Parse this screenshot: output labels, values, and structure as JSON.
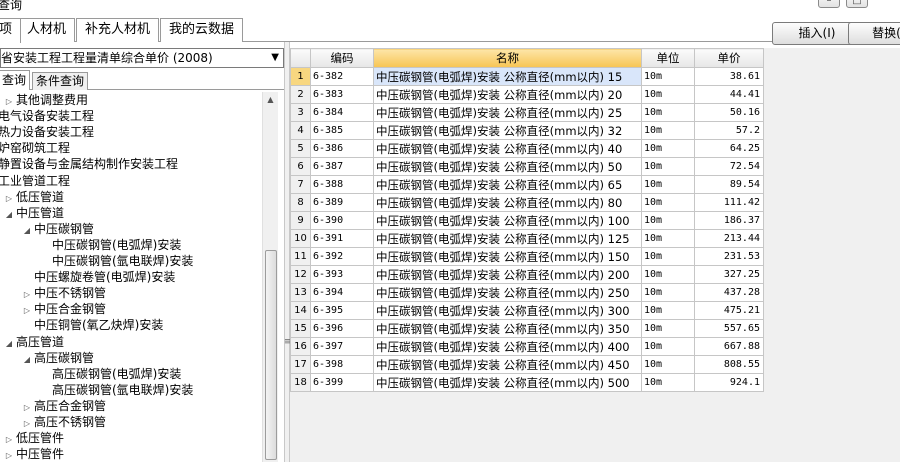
{
  "window": {
    "title": "查询",
    "btn_min": "–",
    "btn_max": "□"
  },
  "tabs": [
    {
      "label": "项",
      "active": true
    },
    {
      "label": "人材机"
    },
    {
      "label": "补充人材机"
    },
    {
      "label": "我的云数据"
    }
  ],
  "toolbar": {
    "insert_label": "插入(I)",
    "replace_label": "替换(R)"
  },
  "left": {
    "selected_library": "省安装工程工程量清单综合单价 (2008)",
    "subtabs": [
      "查询",
      "条件查询"
    ],
    "tree": [
      {
        "label": "其他调整费用",
        "level": 1,
        "toggle": "▷"
      },
      {
        "label": "电气设备安装工程",
        "level": 0,
        "toggle": ""
      },
      {
        "label": "热力设备安装工程",
        "level": 0,
        "toggle": ""
      },
      {
        "label": "炉窑砌筑工程",
        "level": 0,
        "toggle": ""
      },
      {
        "label": "静置设备与金属结构制作安装工程",
        "level": 0,
        "toggle": ""
      },
      {
        "label": "工业管道工程",
        "level": 0,
        "toggle": ""
      },
      {
        "label": "低压管道",
        "level": 1,
        "toggle": "▷"
      },
      {
        "label": "中压管道",
        "level": 1,
        "toggle": "◢"
      },
      {
        "label": "中压碳钢管",
        "level": 2,
        "toggle": "◢"
      },
      {
        "label": "中压碳钢管(电弧焊)安装",
        "level": 3,
        "toggle": ""
      },
      {
        "label": "中压碳钢管(氩电联焊)安装",
        "level": 3,
        "toggle": ""
      },
      {
        "label": "中压螺旋卷管(电弧焊)安装",
        "level": 2,
        "toggle": ""
      },
      {
        "label": "中压不锈钢管",
        "level": 2,
        "toggle": "▷"
      },
      {
        "label": "中压合金钢管",
        "level": 2,
        "toggle": "▷"
      },
      {
        "label": "中压铜管(氧乙炔焊)安装",
        "level": 2,
        "toggle": ""
      },
      {
        "label": "高压管道",
        "level": 1,
        "toggle": "◢"
      },
      {
        "label": "高压碳钢管",
        "level": 2,
        "toggle": "◢"
      },
      {
        "label": "高压碳钢管(电弧焊)安装",
        "level": 3,
        "toggle": ""
      },
      {
        "label": "高压碳钢管(氩电联焊)安装",
        "level": 3,
        "toggle": ""
      },
      {
        "label": "高压合金钢管",
        "level": 2,
        "toggle": "▷"
      },
      {
        "label": "高压不锈钢管",
        "level": 2,
        "toggle": "▷"
      },
      {
        "label": "低压管件",
        "level": 1,
        "toggle": "▷"
      },
      {
        "label": "中压管件",
        "level": 1,
        "toggle": "▷"
      }
    ]
  },
  "grid": {
    "columns": [
      "",
      "编码",
      "名称",
      "单位",
      "单价"
    ],
    "rows": [
      {
        "n": "1",
        "code": "6-382",
        "name": "中压碳钢管(电弧焊)安装 公称直径(mm以内) 15",
        "unit": "10m",
        "price": "38.61"
      },
      {
        "n": "2",
        "code": "6-383",
        "name": "中压碳钢管(电弧焊)安装 公称直径(mm以内) 20",
        "unit": "10m",
        "price": "44.41"
      },
      {
        "n": "3",
        "code": "6-384",
        "name": "中压碳钢管(电弧焊)安装 公称直径(mm以内) 25",
        "unit": "10m",
        "price": "50.16"
      },
      {
        "n": "4",
        "code": "6-385",
        "name": "中压碳钢管(电弧焊)安装 公称直径(mm以内) 32",
        "unit": "10m",
        "price": "57.2"
      },
      {
        "n": "5",
        "code": "6-386",
        "name": "中压碳钢管(电弧焊)安装 公称直径(mm以内) 40",
        "unit": "10m",
        "price": "64.25"
      },
      {
        "n": "6",
        "code": "6-387",
        "name": "中压碳钢管(电弧焊)安装 公称直径(mm以内) 50",
        "unit": "10m",
        "price": "72.54"
      },
      {
        "n": "7",
        "code": "6-388",
        "name": "中压碳钢管(电弧焊)安装 公称直径(mm以内) 65",
        "unit": "10m",
        "price": "89.54"
      },
      {
        "n": "8",
        "code": "6-389",
        "name": "中压碳钢管(电弧焊)安装 公称直径(mm以内) 80",
        "unit": "10m",
        "price": "111.42"
      },
      {
        "n": "9",
        "code": "6-390",
        "name": "中压碳钢管(电弧焊)安装 公称直径(mm以内) 100",
        "unit": "10m",
        "price": "186.37"
      },
      {
        "n": "10",
        "code": "6-391",
        "name": "中压碳钢管(电弧焊)安装 公称直径(mm以内) 125",
        "unit": "10m",
        "price": "213.44"
      },
      {
        "n": "11",
        "code": "6-392",
        "name": "中压碳钢管(电弧焊)安装 公称直径(mm以内) 150",
        "unit": "10m",
        "price": "231.53"
      },
      {
        "n": "12",
        "code": "6-393",
        "name": "中压碳钢管(电弧焊)安装 公称直径(mm以内) 200",
        "unit": "10m",
        "price": "327.25"
      },
      {
        "n": "13",
        "code": "6-394",
        "name": "中压碳钢管(电弧焊)安装 公称直径(mm以内) 250",
        "unit": "10m",
        "price": "437.28"
      },
      {
        "n": "14",
        "code": "6-395",
        "name": "中压碳钢管(电弧焊)安装 公称直径(mm以内) 300",
        "unit": "10m",
        "price": "475.21"
      },
      {
        "n": "15",
        "code": "6-396",
        "name": "中压碳钢管(电弧焊)安装 公称直径(mm以内) 350",
        "unit": "10m",
        "price": "557.65"
      },
      {
        "n": "16",
        "code": "6-397",
        "name": "中压碳钢管(电弧焊)安装 公称直径(mm以内) 400",
        "unit": "10m",
        "price": "667.88"
      },
      {
        "n": "17",
        "code": "6-398",
        "name": "中压碳钢管(电弧焊)安装 公称直径(mm以内) 450",
        "unit": "10m",
        "price": "808.55"
      },
      {
        "n": "18",
        "code": "6-399",
        "name": "中压碳钢管(电弧焊)安装 公称直径(mm以内) 500",
        "unit": "10m",
        "price": "924.1"
      }
    ]
  },
  "icons": {
    "expand": "chevron-right-icon",
    "collapse": "triangle-down-icon",
    "dropdown": "chevron-down-icon"
  }
}
